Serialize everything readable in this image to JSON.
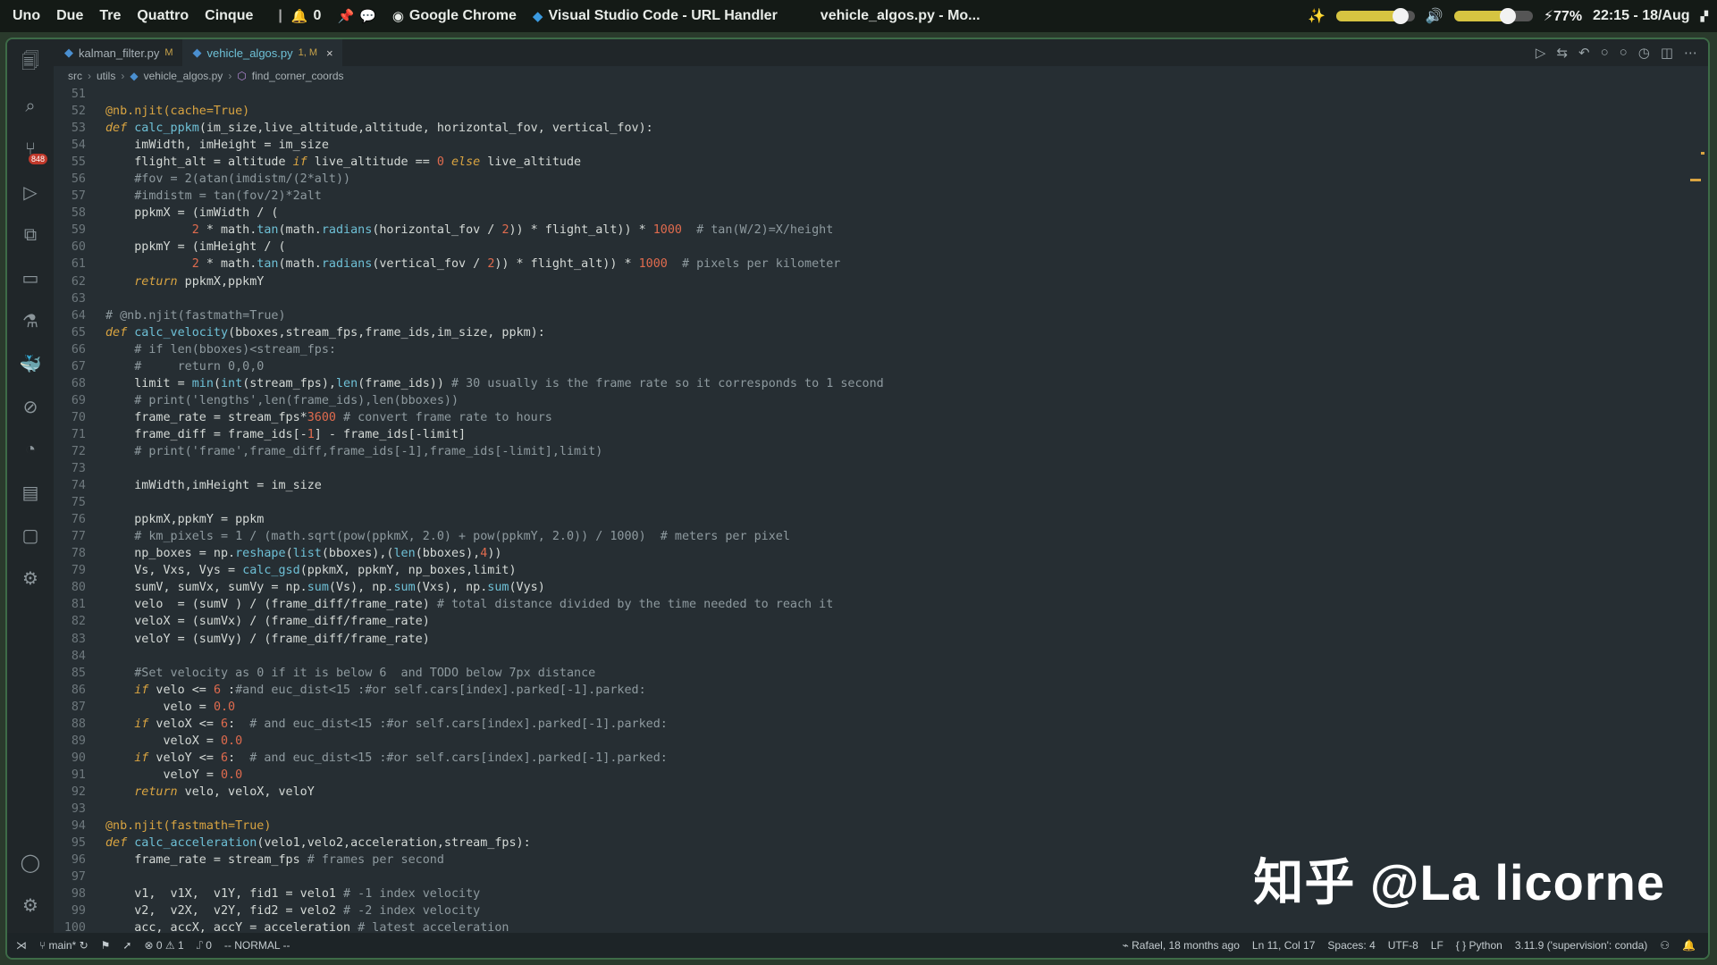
{
  "sysbar": {
    "workspaces": [
      "Uno",
      "Due",
      "Tre",
      "Quattro",
      "Cinque"
    ],
    "separator": "|",
    "notifications": "0",
    "apps": [
      "Google Chrome",
      "Visual Studio Code - URL Handler"
    ],
    "window_title": "vehicle_algos.py - Mo...",
    "battery": "77%",
    "clock": "22:15 - 18/Aug",
    "brightness_level": 0.82,
    "volume_level": 0.68,
    "colors": {
      "slider_fill": "#d6c441",
      "accent": "#3d6b47"
    }
  },
  "tabs": [
    {
      "label": "kalman_filter.py",
      "badge": "M"
    },
    {
      "label": "vehicle_algos.py",
      "badge": "1, M"
    }
  ],
  "breadcrumb": [
    "src",
    "utils",
    "vehicle_algos.py",
    "find_corner_coords"
  ],
  "code_lines": [
    {
      "n": "51",
      "t": ""
    },
    {
      "n": "52",
      "t": "@nb.njit(cache=True)"
    },
    {
      "n": "53",
      "t": "def calc_ppkm(im_size,live_altitude,altitude, horizontal_fov, vertical_fov):"
    },
    {
      "n": "54",
      "t": "    imWidth, imHeight = im_size"
    },
    {
      "n": "55",
      "t": "    flight_alt = altitude if live_altitude == 0 else live_altitude"
    },
    {
      "n": "56",
      "t": "    #fov = 2(atan(imdistm/(2*alt))"
    },
    {
      "n": "57",
      "t": "    #imdistm = tan(fov/2)*2alt"
    },
    {
      "n": "58",
      "t": "    ppkmX = (imWidth / ("
    },
    {
      "n": "59",
      "t": "            2 * math.tan(math.radians(horizontal_fov / 2)) * flight_alt)) * 1000  # tan(W/2)=X/height"
    },
    {
      "n": "60",
      "t": "    ppkmY = (imHeight / ("
    },
    {
      "n": "61",
      "t": "            2 * math.tan(math.radians(vertical_fov / 2)) * flight_alt)) * 1000  # pixels per kilometer"
    },
    {
      "n": "62",
      "t": "    return ppkmX,ppkmY"
    },
    {
      "n": "63",
      "t": ""
    },
    {
      "n": "64",
      "t": "# @nb.njit(fastmath=True)"
    },
    {
      "n": "65",
      "t": "def calc_velocity(bboxes,stream_fps,frame_ids,im_size, ppkm):"
    },
    {
      "n": "66",
      "t": "    # if len(bboxes)<stream_fps:"
    },
    {
      "n": "67",
      "t": "    #     return 0,0,0"
    },
    {
      "n": "68",
      "t": "    limit = min(int(stream_fps),len(frame_ids)) # 30 usually is the frame rate so it corresponds to 1 second"
    },
    {
      "n": "69",
      "t": "    # print('lengths',len(frame_ids),len(bboxes))"
    },
    {
      "n": "70",
      "t": "    frame_rate = stream_fps*3600 # convert frame rate to hours"
    },
    {
      "n": "71",
      "t": "    frame_diff = frame_ids[-1] - frame_ids[-limit]"
    },
    {
      "n": "72",
      "t": "    # print('frame',frame_diff,frame_ids[-1],frame_ids[-limit],limit)"
    },
    {
      "n": "73",
      "t": ""
    },
    {
      "n": "74",
      "t": "    imWidth,imHeight = im_size"
    },
    {
      "n": "75",
      "t": ""
    },
    {
      "n": "76",
      "t": "    ppkmX,ppkmY = ppkm"
    },
    {
      "n": "77",
      "t": "    # km_pixels = 1 / (math.sqrt(pow(ppkmX, 2.0) + pow(ppkmY, 2.0)) / 1000)  # meters per pixel"
    },
    {
      "n": "78",
      "t": "    np_boxes = np.reshape(list(bboxes),(len(bboxes),4))"
    },
    {
      "n": "79",
      "t": "    Vs, Vxs, Vys = calc_gsd(ppkmX, ppkmY, np_boxes,limit)"
    },
    {
      "n": "80",
      "t": "    sumV, sumVx, sumVy = np.sum(Vs), np.sum(Vxs), np.sum(Vys)"
    },
    {
      "n": "81",
      "t": "    velo  = (sumV ) / (frame_diff/frame_rate) # total distance divided by the time needed to reach it"
    },
    {
      "n": "82",
      "t": "    veloX = (sumVx) / (frame_diff/frame_rate)"
    },
    {
      "n": "83",
      "t": "    veloY = (sumVy) / (frame_diff/frame_rate)"
    },
    {
      "n": "84",
      "t": ""
    },
    {
      "n": "85",
      "t": "    #Set velocity as 0 if it is below 6  and TODO below 7px distance"
    },
    {
      "n": "86",
      "t": "    if velo <= 6 :#and euc_dist<15 :#or self.cars[index].parked[-1].parked:"
    },
    {
      "n": "87",
      "t": "        velo = 0.0"
    },
    {
      "n": "88",
      "t": "    if veloX <= 6:  # and euc_dist<15 :#or self.cars[index].parked[-1].parked:"
    },
    {
      "n": "89",
      "t": "        veloX = 0.0"
    },
    {
      "n": "90",
      "t": "    if veloY <= 6:  # and euc_dist<15 :#or self.cars[index].parked[-1].parked:"
    },
    {
      "n": "91",
      "t": "        veloY = 0.0"
    },
    {
      "n": "92",
      "t": "    return velo, veloX, veloY"
    },
    {
      "n": "93",
      "t": ""
    },
    {
      "n": "94",
      "t": "@nb.njit(fastmath=True)"
    },
    {
      "n": "95",
      "t": "def calc_acceleration(velo1,velo2,acceleration,stream_fps):"
    },
    {
      "n": "96",
      "t": "    frame_rate = stream_fps # frames per second"
    },
    {
      "n": "97",
      "t": ""
    },
    {
      "n": "98",
      "t": "    v1,  v1X,  v1Y, fid1 = velo1 # -1 index velocity"
    },
    {
      "n": "99",
      "t": "    v2,  v2X,  v2Y, fid2 = velo2 # -2 index velocity"
    },
    {
      "n": "100",
      "t": "    acc, accX, accY = acceleration # latest acceleration"
    }
  ],
  "statusbar": {
    "branch": "main*",
    "errors": "0",
    "warnings": "1",
    "ports": "0",
    "mode": "-- NORMAL --",
    "blame": "Rafael, 18 months ago",
    "cursor": "Ln 11, Col 17",
    "spaces": "Spaces: 4",
    "encoding": "UTF-8",
    "eol": "LF",
    "language": "Python",
    "interpreter": "3.11.9 ('supervision': conda)"
  },
  "activity_badge": "848",
  "watermark": "知乎 @La licorne"
}
